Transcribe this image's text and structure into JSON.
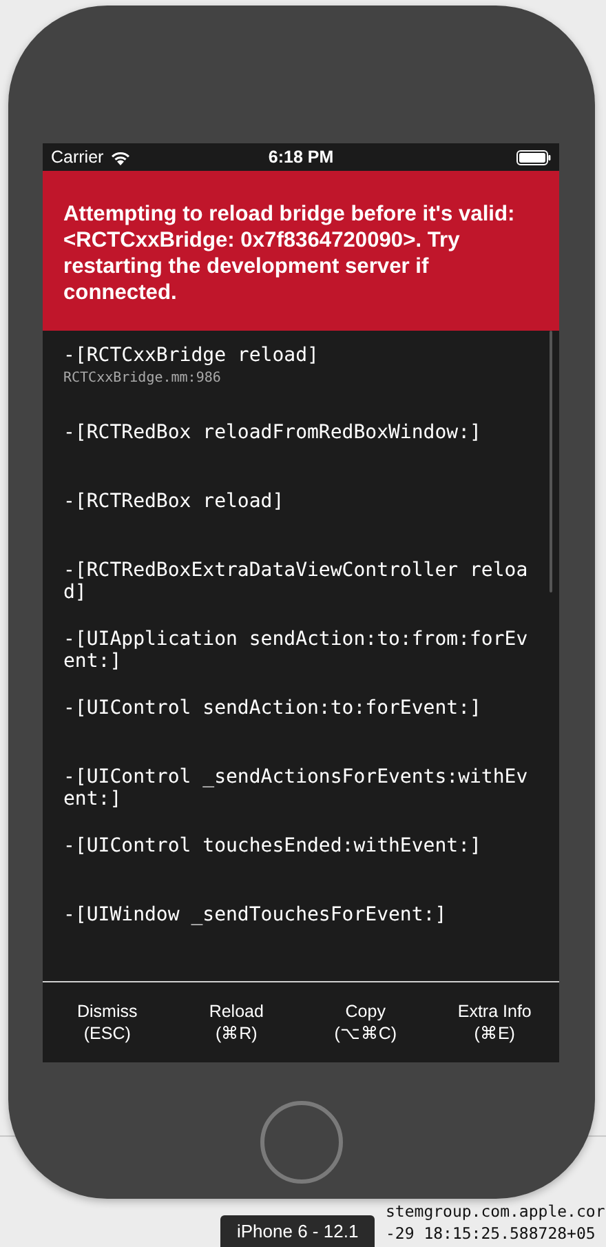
{
  "status_bar": {
    "carrier": "Carrier",
    "time": "6:18 PM"
  },
  "error": {
    "message": "Attempting to reload bridge before it's valid: <RCTCxxBridge: 0x7f8364720090>. Try restarting the development server if connected."
  },
  "stack": [
    {
      "method": "-[RCTCxxBridge reload]",
      "file": "RCTCxxBridge.mm:986"
    },
    {
      "method": "-[RCTRedBox reloadFromRedBoxWindow:]"
    },
    {
      "method": "-[RCTRedBox reload]"
    },
    {
      "method": "-[RCTRedBoxExtraDataViewController reload]"
    },
    {
      "method": "-[UIApplication sendAction:to:from:forEvent:]"
    },
    {
      "method": "-[UIControl sendAction:to:forEvent:]"
    },
    {
      "method": "-[UIControl _sendActionsForEvents:withEvent:]"
    },
    {
      "method": "-[UIControl touchesEnded:withEvent:]"
    },
    {
      "method": "-[UIWindow _sendTouchesForEvent:]"
    }
  ],
  "buttons": [
    {
      "label": "Dismiss",
      "shortcut": "(ESC)"
    },
    {
      "label": "Reload",
      "shortcut": "(⌘R)"
    },
    {
      "label": "Copy",
      "shortcut": "(⌥⌘C)"
    },
    {
      "label": "Extra Info",
      "shortcut": "(⌘E)"
    }
  ],
  "device_label": "iPhone 6 - 12.1",
  "console_lines": [
    "stemgroup.com.apple.cor",
    "-29 18:15:25.588728+05"
  ]
}
